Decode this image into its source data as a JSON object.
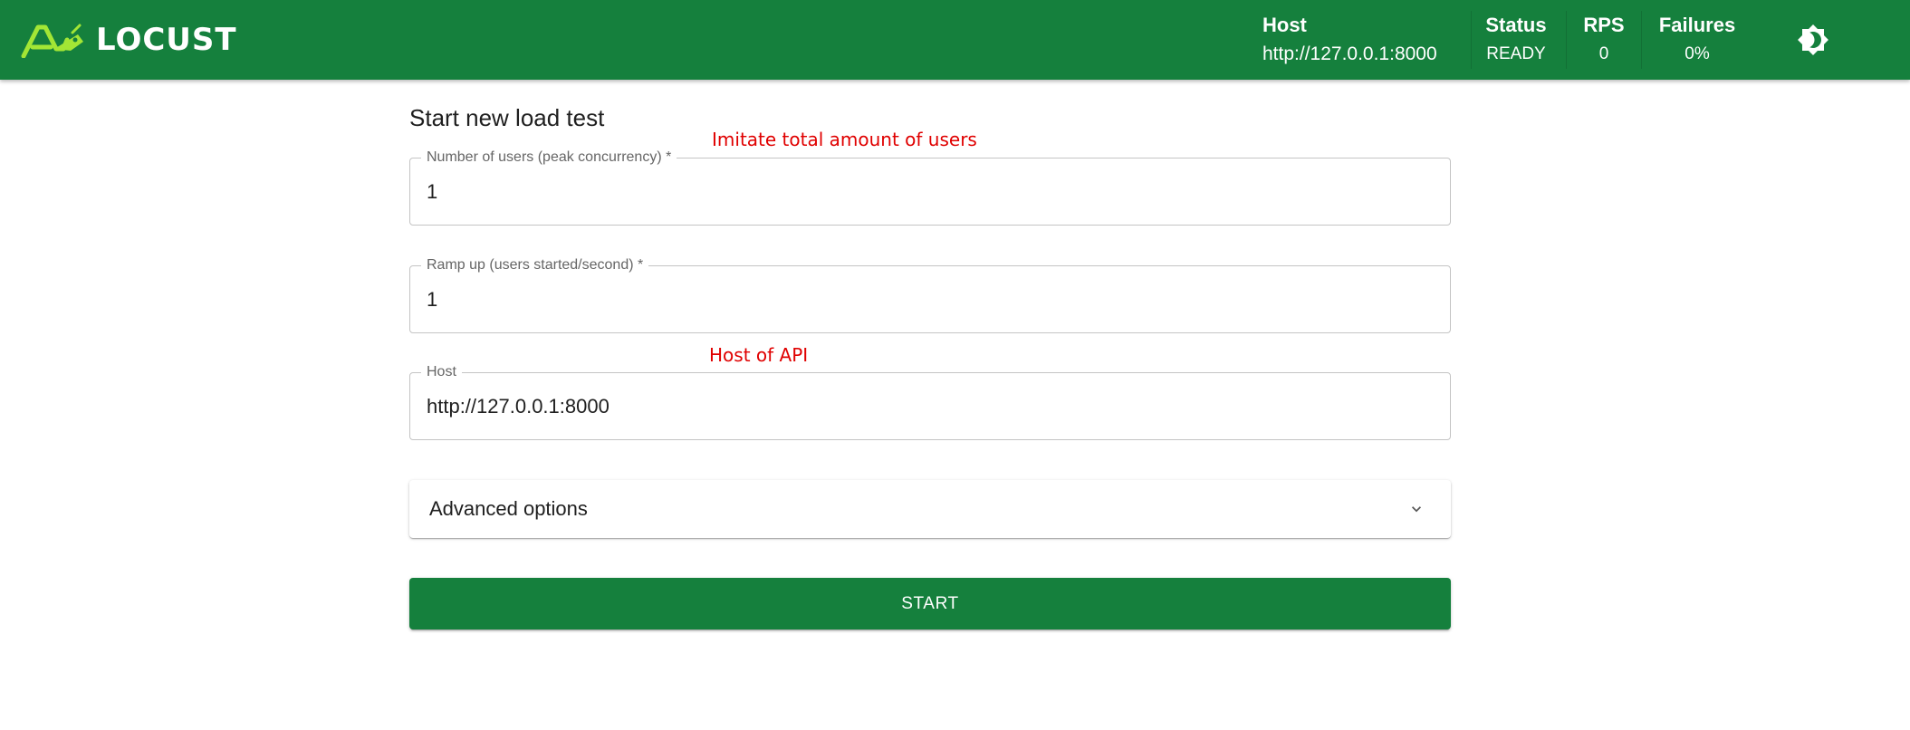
{
  "header": {
    "brand": "LOCUST",
    "stats": {
      "host_label": "Host",
      "host_value": "http://127.0.0.1:8000",
      "status_label": "Status",
      "status_value": "READY",
      "rps_label": "RPS",
      "rps_value": "0",
      "failures_label": "Failures",
      "failures_value": "0%"
    },
    "theme_toggle_icon": "brightness-icon"
  },
  "form": {
    "title": "Start new load test",
    "fields": [
      {
        "label": "Number of users (peak concurrency) *",
        "value": "1"
      },
      {
        "label": "Ramp up (users started/second) *",
        "value": "1"
      },
      {
        "label": "Host",
        "value": "http://127.0.0.1:8000"
      }
    ],
    "advanced_options_label": "Advanced options",
    "start_label": "START"
  },
  "annotations": {
    "users_note": "Imitate total amount of users",
    "host_note": "Host of API"
  },
  "colors": {
    "brand_green": "#15803d",
    "logo_lime": "#a3e635",
    "annotation_red": "#e00000"
  }
}
